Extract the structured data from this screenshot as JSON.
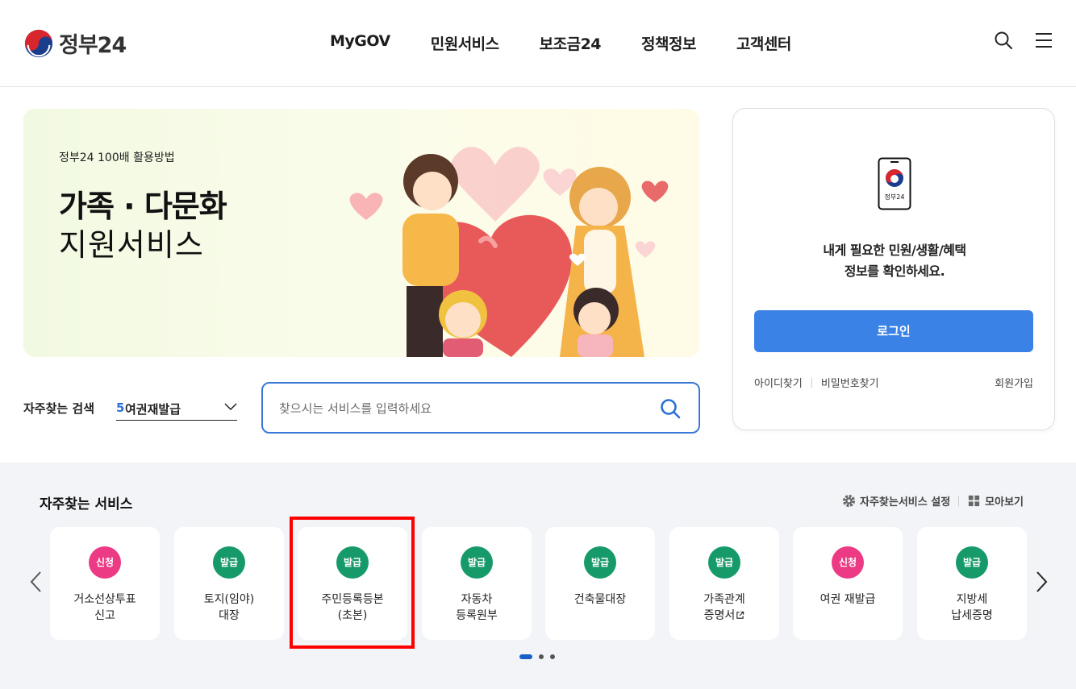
{
  "header": {
    "logo_text": "정부24",
    "nav": [
      {
        "label": "MyGOV"
      },
      {
        "label": "민원서비스"
      },
      {
        "label": "보조금24"
      },
      {
        "label": "정책정보"
      },
      {
        "label": "고객센터"
      }
    ]
  },
  "banner": {
    "subtitle": "정부24 100배 활용방법",
    "title_line1": "가족 · 다문화",
    "title_line2": "지원서비스"
  },
  "search": {
    "freq_label": "자주찾는 검색",
    "freq_rank": "5",
    "freq_value": "여권재발급",
    "placeholder": "찾으시는 서비스를 입력하세요"
  },
  "login": {
    "phone_label": "정부24",
    "message_line1": "내게 필요한 민원/생활/혜택",
    "message_line2": "정보를 확인하세요.",
    "button": "로그인",
    "find_id": "아이디찾기",
    "find_pw": "비밀번호찾기",
    "signup": "회원가입"
  },
  "services": {
    "title": "자주찾는 서비스",
    "settings": "자주찾는서비스 설정",
    "view_all": "모아보기",
    "cards": [
      {
        "badge": "신청",
        "type": "apply",
        "line1": "거소선상투표",
        "line2": "신고"
      },
      {
        "badge": "발급",
        "type": "issue",
        "line1": "토지(임야)",
        "line2": "대장"
      },
      {
        "badge": "발급",
        "type": "issue",
        "line1": "주민등록등본",
        "line2": "(초본)"
      },
      {
        "badge": "발급",
        "type": "issue",
        "line1": "자동차",
        "line2": "등록원부"
      },
      {
        "badge": "발급",
        "type": "issue",
        "line1": "건축물대장",
        "line2": ""
      },
      {
        "badge": "발급",
        "type": "issue",
        "line1": "가족관계",
        "line2": "증명서"
      },
      {
        "badge": "신청",
        "type": "apply",
        "line1": "여권 재발급",
        "line2": ""
      },
      {
        "badge": "발급",
        "type": "issue",
        "line1": "지방세",
        "line2": "납세증명"
      }
    ],
    "pagination": {
      "current": 1,
      "total": 3
    }
  },
  "colors": {
    "primary": "#3b82e6",
    "apply_badge": "#ec3a84",
    "issue_badge": "#179a6a",
    "highlight": "#ff0000"
  }
}
